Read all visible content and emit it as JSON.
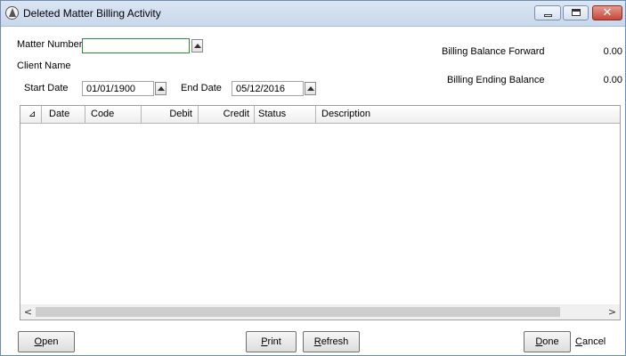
{
  "window": {
    "title": "Deleted Matter Billing Activity",
    "close_glyph": "✕"
  },
  "filters": {
    "matter_number_label": "Matter Number",
    "matter_number_value": "",
    "client_name_label": "Client Name",
    "start_date_label": "Start Date",
    "start_date_value": "01/01/1900",
    "end_date_label": "End Date",
    "end_date_value": "05/12/2016"
  },
  "balances": {
    "forward_label": "Billing Balance  Forward",
    "forward_value": "0.00",
    "ending_label": "Billing Ending Balance",
    "ending_value": "0.00"
  },
  "grid": {
    "sort_glyph": "⊿",
    "columns": [
      "Date",
      "Code",
      "Debit",
      "Credit",
      "Status",
      "Description"
    ],
    "rows": [],
    "scroll_left": "<",
    "scroll_right": ">"
  },
  "buttons": {
    "open": {
      "accel": "O",
      "rest": "pen"
    },
    "print": {
      "accel": "P",
      "rest": "rint"
    },
    "refresh": {
      "accel": "R",
      "rest": "efresh"
    },
    "done": {
      "accel": "D",
      "rest": "one"
    },
    "cancel": {
      "accel": "C",
      "rest": "ancel"
    }
  },
  "colors": {
    "title_bar": "#c8d7ea",
    "close_button": "#c4473a",
    "focus_border": "#2e8b2e"
  }
}
